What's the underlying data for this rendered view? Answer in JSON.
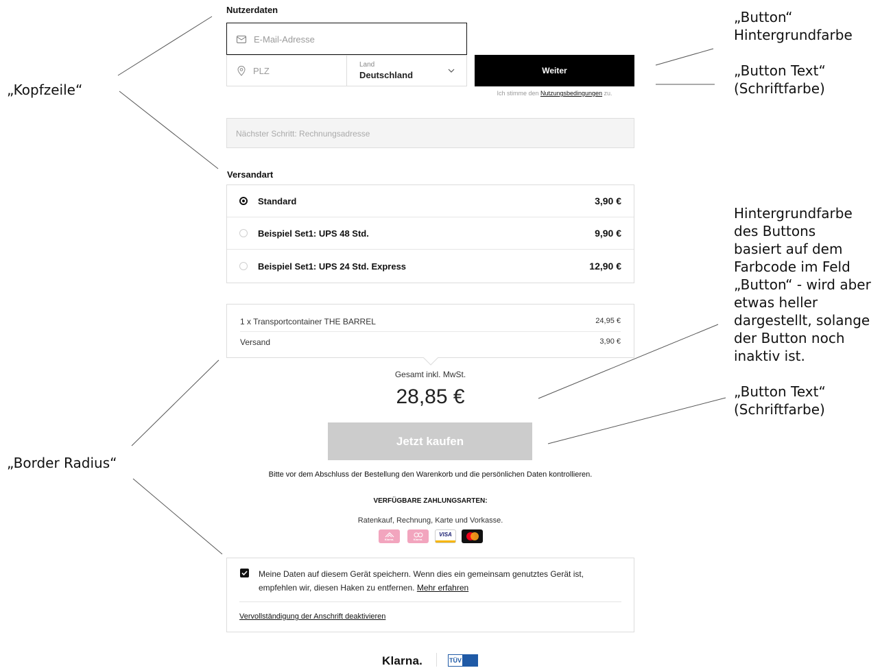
{
  "form": {
    "user_section_title": "Nutzerdaten",
    "email_placeholder": "E-Mail-Adresse",
    "zip_placeholder": "PLZ",
    "country_label": "Land",
    "country_value": "Deutschland",
    "continue_button": "Weiter",
    "terms_prefix": "Ich stimme den ",
    "terms_link": "Nutzungsbedingungen",
    "terms_suffix": " zu.",
    "next_step": "Nächster Schritt: Rechnungsadresse",
    "shipping_section_title": "Versandart",
    "shipping_options": [
      {
        "label": "Standard",
        "price": "3,90 €",
        "selected": true
      },
      {
        "label": "Beispiel Set1: UPS 48 Std.",
        "price": "9,90 €",
        "selected": false
      },
      {
        "label": "Beispiel Set1: UPS 24 Std. Express",
        "price": "12,90 €",
        "selected": false
      }
    ],
    "summary": {
      "item_label": "1 x Transportcontainer THE BARREL",
      "item_price": "24,95 €",
      "shipping_label": "Versand",
      "shipping_price": "3,90 €",
      "total_label": "Gesamt inkl. MwSt.",
      "total_value": "28,85 €"
    },
    "buy_button": "Jetzt kaufen",
    "review_note": "Bitte vor dem Abschluss der Bestellung den Warenkorb und die persönlichen Daten kontrollieren.",
    "payment_title": "VERFÜGBARE ZAHLUNGSARTEN:",
    "payment_methods_text": "Ratenkauf, Rechnung, Karte und Vorkasse.",
    "payment_logos": [
      {
        "icon": "klarna-installments-icon",
        "text": "Klarna."
      },
      {
        "icon": "klarna-invoice-icon",
        "text": "Klarna."
      },
      {
        "icon": "visa-icon",
        "text": "VISA"
      },
      {
        "icon": "mastercard-icon",
        "text": "mastercard"
      }
    ],
    "remember_text": "Meine Daten auf diesem Gerät speichern. Wenn dies ein gemeinsam genutztes Gerät ist, empfehlen wir, diesen Haken zu entfernen.",
    "remember_link": "Mehr erfahren",
    "remember_checked": true,
    "autocomplete_link": "Vervollständigung der Anschrift deaktivieren",
    "footer_brand": "Klarna.",
    "tuv_text": "TÜV"
  },
  "colors": {
    "button_bg": "#000000",
    "button_text": "#ffffff",
    "buy_button_bg_inactive": "#cccccc",
    "buy_button_text": "#ffffff",
    "klarna_pink": "#f2a5be"
  },
  "annotations": {
    "kopfzeile": "„Kopfzeile“",
    "button_bg": "„Button“\nHintergrundfarbe",
    "button_text_top": "„Button Text“\n(Schriftfarbe)",
    "inactive_note": "Hintergrundfarbe\ndes Buttons\nbasiert auf dem\nFarbcode im Feld\n„Button“ - wird aber\netwas heller\ndargestellt, solange\nder Button noch\ninaktiv ist.",
    "button_text_bottom": "„Button Text“\n(Schriftfarbe)",
    "border_radius": "„Border Radius“"
  }
}
